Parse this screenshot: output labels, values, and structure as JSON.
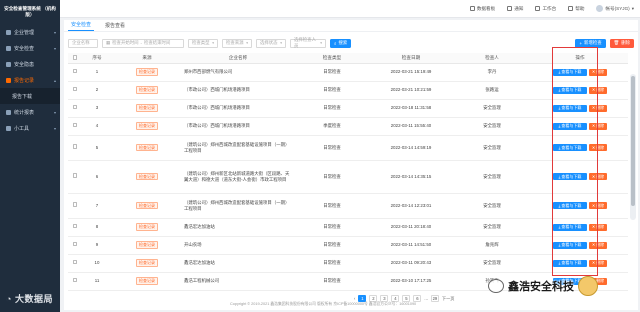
{
  "sidebar": {
    "brand": "安全检查管理系统 （机构版）",
    "items": [
      {
        "label": "企业管理",
        "active": false
      },
      {
        "label": "安全检查",
        "active": false
      },
      {
        "label": "安全隐患",
        "active": false
      },
      {
        "label": "报告记录",
        "active": true
      },
      {
        "label": "报告下载",
        "sub": true
      },
      {
        "label": "统计报表",
        "active": false
      },
      {
        "label": "小工具",
        "active": false
      }
    ]
  },
  "topbar": {
    "items": [
      {
        "label": "数据看板"
      },
      {
        "label": "通知"
      },
      {
        "label": "工作台"
      },
      {
        "label": "帮助"
      },
      {
        "label": "帐号(SYJG)"
      }
    ]
  },
  "tabs": [
    {
      "label": "安全检查",
      "active": true
    },
    {
      "label": "报告查看",
      "active": false
    }
  ],
  "filters": {
    "company_placeholder": "企业名称",
    "date_start": "检查开始时间",
    "date_end": "检查结束时间",
    "type_placeholder": "检查类型",
    "source_placeholder": "检查来源",
    "status_placeholder": "选择状态",
    "people_placeholder": "选择检查人员",
    "search_label": "搜索",
    "new_label": "新增检查",
    "delete_label": "删除"
  },
  "table": {
    "headers": [
      "序号",
      "来源",
      "企业名称",
      "检查类型",
      "检查日期",
      "检查人",
      "操作"
    ],
    "op_view_label": "查看与下载",
    "op_delete_label": "删除",
    "rows": [
      {
        "no": "1",
        "source": "检查记录",
        "company": "郑州市西部燃气有限公司",
        "type": "日常检查",
        "date": "2022-03-21 15:19:49",
        "inspector": "李丹"
      },
      {
        "no": "2",
        "source": "检查记录",
        "company": "（市政公司）西城门机场港路项目",
        "type": "日常检查",
        "date": "2022-03-21 10:21:59",
        "inspector": "张路运"
      },
      {
        "no": "3",
        "source": "检查记录",
        "company": "（市政公司）西城门机场港路项目",
        "type": "日常检查",
        "date": "2022-03-18 11:31:58",
        "inspector": "安全监理"
      },
      {
        "no": "4",
        "source": "检查记录",
        "company": "（市政公司）西城门机场港路项目",
        "type": "季度检查",
        "date": "2022-03-11 15:55:40",
        "inspector": "安全监理"
      },
      {
        "no": "5",
        "source": "检查记录",
        "company": "（建筑公司）郑州西城改造配套基础设施项目（一期）工程项目",
        "type": "日常检查",
        "date": "2022-03-14 14:59:19",
        "inspector": "安全监理"
      },
      {
        "no": "6",
        "source": "检查记录",
        "company": "（建筑公司）郑州新区北站新城道路大街（区段路、天翼大道）和德大道（道东大街-人会街）市政工程项目",
        "type": "日常检查",
        "date": "2022-03-14 14:35:15",
        "inspector": "安全监理"
      },
      {
        "no": "7",
        "source": "检查记录",
        "company": "（建筑公司）郑州西城改造配套基础设施项目（一期）工程项目",
        "type": "日常检查",
        "date": "2022-03-14 12:23:01",
        "inspector": "安全监理"
      },
      {
        "no": "8",
        "source": "检查记录",
        "company": "鑫浩宏达加油站",
        "type": "日常检查",
        "date": "2022-03-11 20:18:40",
        "inspector": "安全监理"
      },
      {
        "no": "9",
        "source": "检查记录",
        "company": "开山农场",
        "type": "日常检查",
        "date": "2022-03-11 14:51:50",
        "inspector": "詹兆辉"
      },
      {
        "no": "10",
        "source": "检查记录",
        "company": "鑫浩宏达加油站",
        "type": "日常检查",
        "date": "2022-03-11 09:20:43",
        "inspector": "安全监理"
      },
      {
        "no": "11",
        "source": "检查记录",
        "company": "鑫浩工程机械公司",
        "type": "日常检查",
        "date": "2022-03-10 17:17:25",
        "inspector": "孙某飞"
      }
    ]
  },
  "pager": {
    "pages": [
      "1",
      "2",
      "3",
      "4",
      "5",
      "6",
      "...",
      "29"
    ],
    "active": "1",
    "next_label": "下一页"
  },
  "footer": "Copyright © 2019-2021 鑫浩集团科技股份有限公司 版权所有 京ICP备10000000号 鑫浩官方公众号：16001090",
  "watermarks": {
    "left": "大数据局",
    "right": "鑫浩安全科技"
  }
}
